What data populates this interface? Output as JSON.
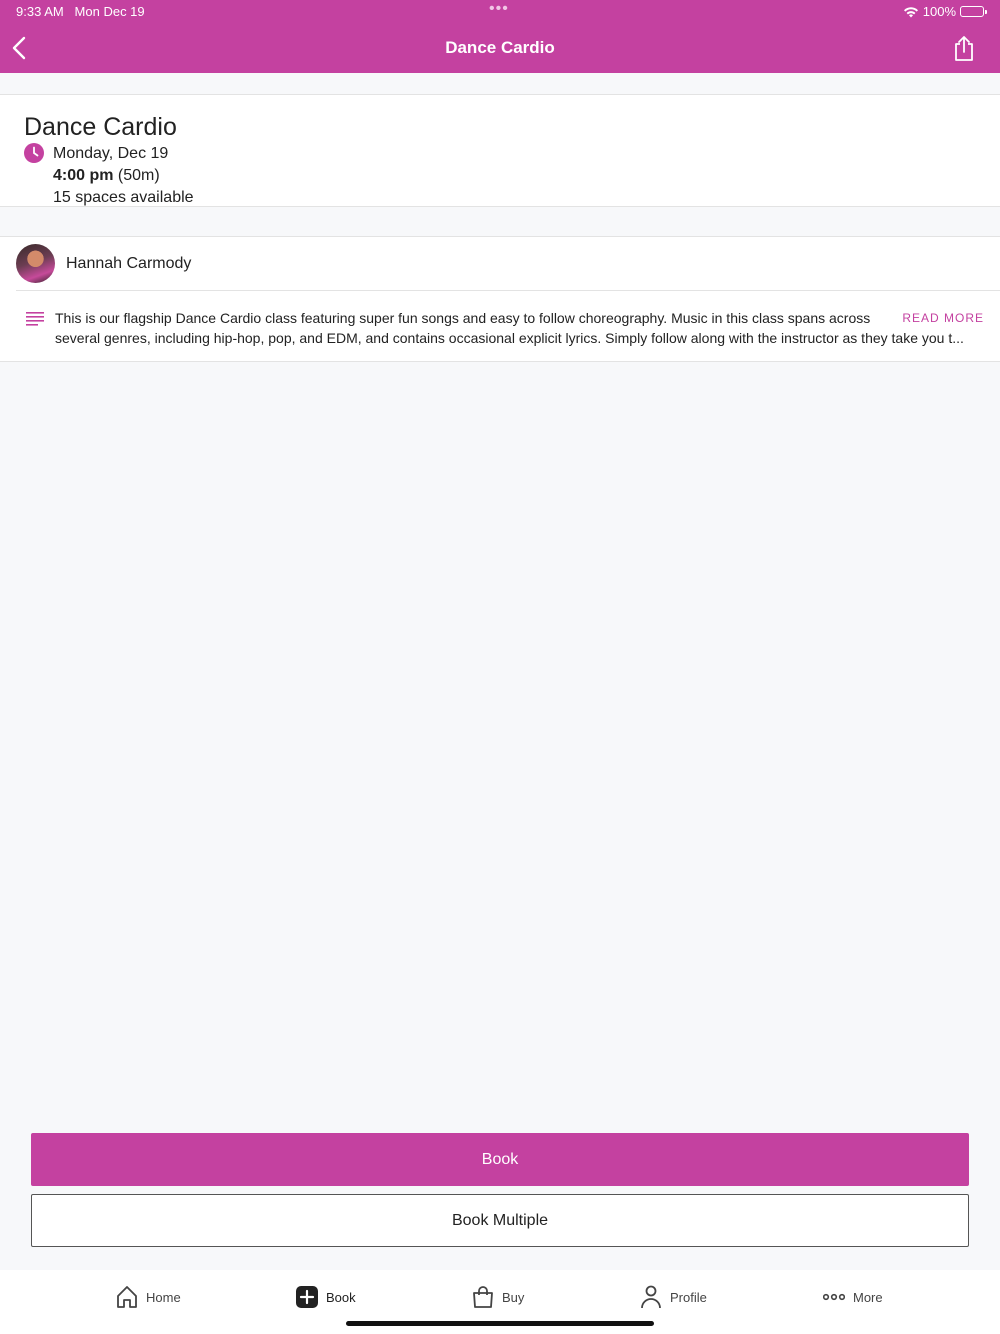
{
  "status_bar": {
    "time": "9:33 AM",
    "date": "Mon Dec 19",
    "dots": "•••",
    "battery": "100%"
  },
  "header": {
    "title": "Dance Cardio",
    "background_color": "#c441a0",
    "back_icon": "chevron-left-icon",
    "share_icon": "share-icon"
  },
  "class_info": {
    "title": "Dance Cardio",
    "date": "Monday, Dec 19",
    "start_time": "4:00 pm",
    "duration": "(50m)",
    "spaces": "15 spaces available"
  },
  "instructor": {
    "name": "Hannah Carmody"
  },
  "description": {
    "line1": "This is our flagship Dance Cardio class featuring super fun songs and easy to follow choreography. Music in this class spans across",
    "line2": "several genres, including hip-hop, pop, and EDM, and contains occasional explicit lyrics. Simply follow along with the instructor as they take you t...",
    "read_more": "READ MORE"
  },
  "actions": {
    "book": "Book",
    "book_multiple": "Book Multiple"
  },
  "tabs": [
    {
      "label": "Home",
      "icon": "home-icon"
    },
    {
      "label": "Book",
      "icon": "plus-square-icon"
    },
    {
      "label": "Buy",
      "icon": "shopping-bag-icon"
    },
    {
      "label": "Profile",
      "icon": "person-icon"
    },
    {
      "label": "More",
      "icon": "more-dots-icon"
    }
  ],
  "accent_color": "#c441a0"
}
